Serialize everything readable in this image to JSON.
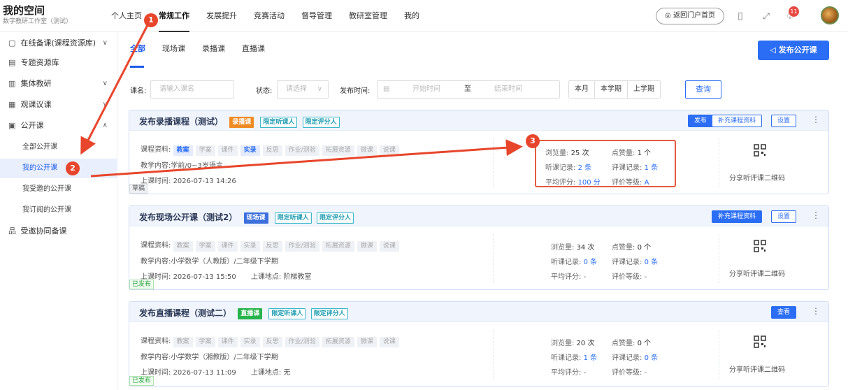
{
  "brand": {
    "title": "我的空间",
    "subtitle": "数字教研工作室（测试）"
  },
  "nav": {
    "items": [
      {
        "label": "个人主页"
      },
      {
        "label": "常规工作",
        "active": true
      },
      {
        "label": "发展提升"
      },
      {
        "label": "竞赛活动"
      },
      {
        "label": "督导管理"
      },
      {
        "label": "教研室管理"
      },
      {
        "label": "我的"
      }
    ]
  },
  "header": {
    "portal_label": "返回门户首页",
    "notification_count": "11"
  },
  "sidebar": {
    "items": [
      {
        "label": "在线备课(课程资源库)",
        "icon": "doc-icon",
        "chev": "∨"
      },
      {
        "label": "专题资源库",
        "icon": "library-icon"
      },
      {
        "label": "集体教研",
        "icon": "group-icon",
        "chev": "∨"
      },
      {
        "label": "观课议课",
        "icon": "classroom-icon",
        "chev": "∨"
      },
      {
        "label": "公开课",
        "icon": "public-class-icon",
        "chev": "∧"
      }
    ],
    "subitems": [
      {
        "label": "全部公开课"
      },
      {
        "label": "我的公开课",
        "active": true
      },
      {
        "label": "我受邀的公开课"
      },
      {
        "label": "我订阅的公开课"
      }
    ],
    "extra": {
      "label": "受邀协同备课",
      "icon": "collab-icon"
    }
  },
  "tabs": [
    {
      "label": "全部",
      "active": true
    },
    {
      "label": "现场课"
    },
    {
      "label": "录播课"
    },
    {
      "label": "直播课"
    }
  ],
  "publish_button": "发布公开课",
  "filters": {
    "course_label": "课名:",
    "course_placeholder": "请输入课名",
    "status_label": "状态:",
    "status_placeholder": "请选择",
    "time_label": "发布时间:",
    "start_placeholder": "开始时间",
    "to": "至",
    "end_placeholder": "结束时间",
    "ranges": [
      "本月",
      "本学期",
      "上学期"
    ],
    "query": "查询"
  },
  "labels": {
    "resources": "课程资料:",
    "content": "教学内容:",
    "time": "上课时间:",
    "location": "上课地点:",
    "views": "浏览量:",
    "likes": "点赞量:",
    "listen": "听课记录:",
    "review": "评课记录:",
    "avg": "平均评分:",
    "grade": "评价等级:",
    "qr": "分享听评课二维码"
  },
  "resource_tags": [
    "教案",
    "学案",
    "课件",
    "实录",
    "反思",
    "作业/测验",
    "拓展资源",
    "微课",
    "说课"
  ],
  "courses": [
    {
      "title": "发布录播课程（测试）",
      "type_tag": "录播课",
      "tags": [
        "限定听课人",
        "限定评分人"
      ],
      "active_resources": [
        "教案",
        "实录"
      ],
      "content": "学前/0~3岁语言",
      "time": "2026-07-13 14:26",
      "location": "",
      "views": "25 次",
      "likes": "1 个",
      "listen": "2 条",
      "review": "1 条",
      "avg": "100 分",
      "grade": "A",
      "status": "草稿",
      "actions": [
        "发布",
        "补充课程资料",
        "设置"
      ]
    },
    {
      "title": "发布现场公开课（测试2）",
      "type_tag": "现场课",
      "tags": [
        "限定听课人",
        "限定评分人"
      ],
      "active_resources": [],
      "content": "小学数学（人教版）/二年级下学期",
      "time": "2026-07-13 15:50",
      "location": "阶梯教室",
      "views": "34 次",
      "likes": "0 个",
      "listen": "0 条",
      "review": "0 条",
      "avg": "-",
      "grade": "-",
      "status": "已发布",
      "actions": [
        "补充课程资料",
        "设置"
      ]
    },
    {
      "title": "发布直播课程（测试二）",
      "type_tag": "直播课",
      "tags": [
        "限定听课人",
        "限定评分人"
      ],
      "active_resources": [],
      "content": "小学数学（湘教版）/二年级下学期",
      "time": "2026-07-13 11:09",
      "location": "无",
      "views": "20 次",
      "likes": "0 个",
      "listen": "1 条",
      "review": "0 条",
      "avg": "-",
      "grade": "-",
      "status": "已发布",
      "actions": [
        "查看"
      ]
    }
  ],
  "annotations": [
    "1",
    "2",
    "3"
  ],
  "colors": {
    "accent": "#2b6ef5",
    "marker": "#e8462c",
    "record": "#f08b22",
    "live_site": "#3c6fdc",
    "stream": "#27b34b"
  }
}
